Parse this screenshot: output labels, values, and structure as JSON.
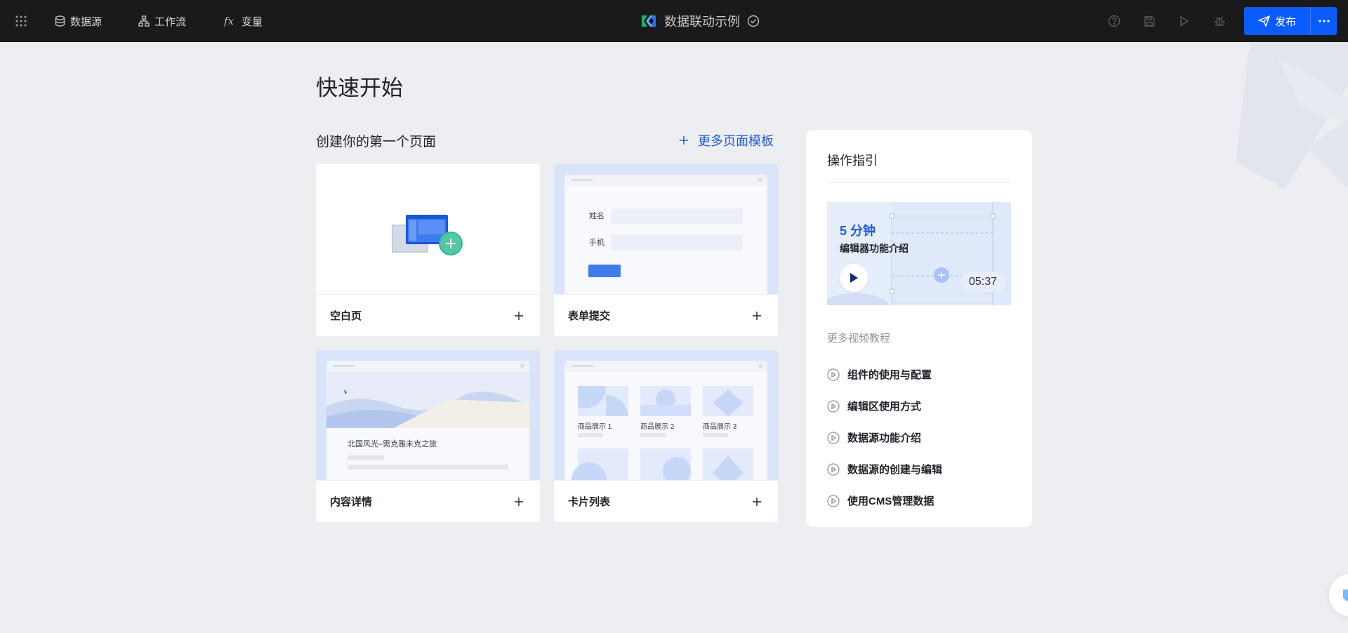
{
  "topbar": {
    "nav": [
      {
        "label": "数据源",
        "icon": "database-icon"
      },
      {
        "label": "工作流",
        "icon": "workflow-icon"
      },
      {
        "label": "变量",
        "icon": "fx-icon"
      }
    ],
    "app_title": "数据联动示例",
    "publish_label": "发布"
  },
  "main": {
    "title": "快速开始",
    "section_title": "创建你的第一个页面",
    "more_templates_label": "更多页面模板",
    "cards": [
      {
        "label": "空白页"
      },
      {
        "label": "表单提交",
        "preview": {
          "field1": "姓名",
          "field2": "手机"
        }
      },
      {
        "label": "内容详情",
        "preview": {
          "caption": "北国风光–需克雅未克之旅"
        }
      },
      {
        "label": "卡片列表",
        "preview": {
          "items": [
            "商品展示 1",
            "商品展示 2",
            "商品展示 3"
          ]
        }
      }
    ]
  },
  "guide": {
    "title": "操作指引",
    "video": {
      "minutes": "5 分钟",
      "subtitle": "编辑器功能介绍",
      "duration": "05:37"
    },
    "more_label": "更多视频教程",
    "items": [
      {
        "label": "组件的使用与配置"
      },
      {
        "label": "编辑区使用方式"
      },
      {
        "label": "数据源功能介绍"
      },
      {
        "label": "数据源的创建与编辑"
      },
      {
        "label": "使用CMS管理数据"
      }
    ]
  },
  "colors": {
    "topbar": "#1a1a1a",
    "accent": "#0a5cff",
    "link": "#1e5bd9",
    "page_bg": "#edeef2",
    "thumb_bg": "#d9e4fb"
  }
}
